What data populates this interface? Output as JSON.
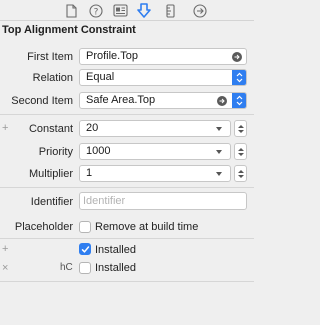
{
  "tabs": [
    {
      "icon": "file-icon"
    },
    {
      "icon": "help-icon"
    },
    {
      "icon": "identity-icon"
    },
    {
      "icon": "attributes-icon",
      "active": true
    },
    {
      "icon": "ruler-icon"
    },
    {
      "icon": "connections-icon"
    }
  ],
  "section_title": "Top Alignment Constraint",
  "first_item": {
    "label": "First Item",
    "value": "Profile.Top"
  },
  "relation": {
    "label": "Relation",
    "value": "Equal"
  },
  "second_item": {
    "label": "Second Item",
    "value": "Safe Area.Top"
  },
  "constant": {
    "label": "Constant",
    "value": "20"
  },
  "priority": {
    "label": "Priority",
    "value": "1000"
  },
  "multiplier": {
    "label": "Multiplier",
    "value": "1"
  },
  "identifier": {
    "label": "Identifier",
    "placeholder": "Identifier"
  },
  "placeholder_row": {
    "label": "Placeholder",
    "checkbox_label": "Remove at build time",
    "checked": false
  },
  "installed_row1": {
    "checkbox_label": "Installed",
    "checked": true
  },
  "installed_row2": {
    "size_class": "hC",
    "checkbox_label": "Installed",
    "checked": false
  },
  "colors": {
    "accent": "#2f7ef0",
    "background": "#efefef"
  }
}
